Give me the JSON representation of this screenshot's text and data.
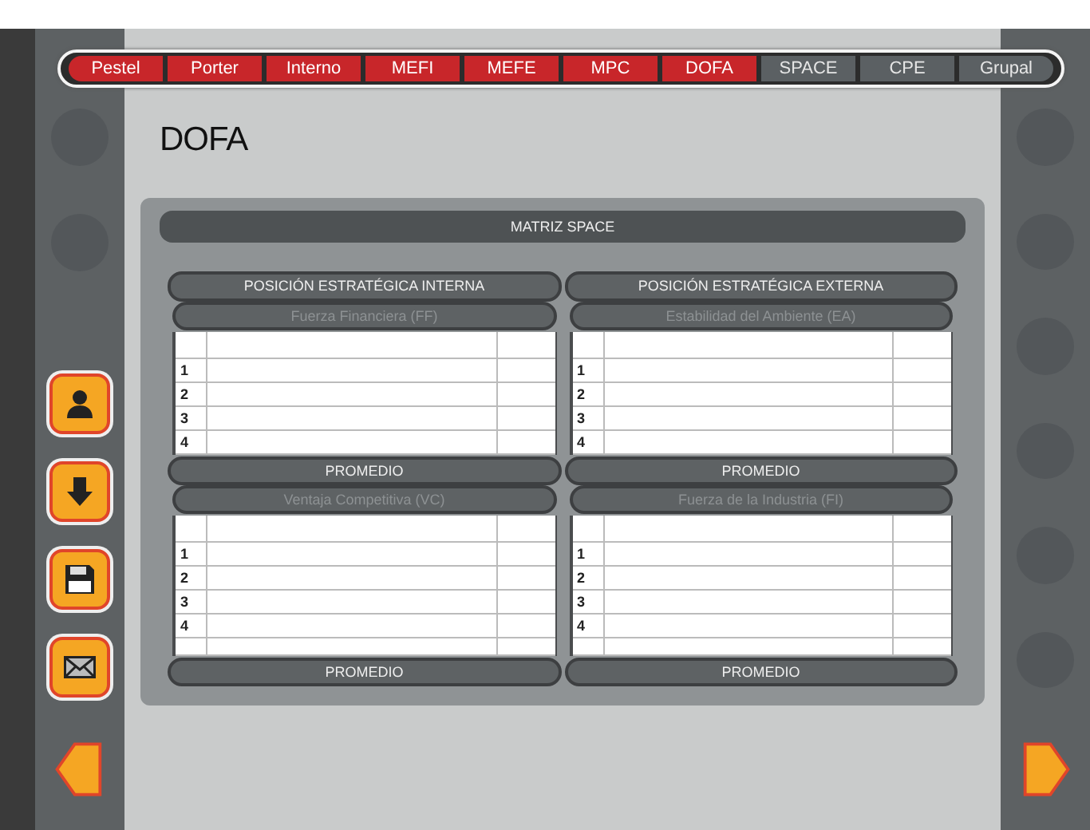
{
  "tabs": [
    {
      "label": "Pestel",
      "completed": true
    },
    {
      "label": "Porter",
      "completed": true
    },
    {
      "label": "Interno",
      "completed": true
    },
    {
      "label": "MEFI",
      "completed": true
    },
    {
      "label": "MEFE",
      "completed": true
    },
    {
      "label": "MPC",
      "completed": true
    },
    {
      "label": "DOFA",
      "completed": true
    },
    {
      "label": "SPACE",
      "completed": false
    },
    {
      "label": "CPE",
      "completed": false
    },
    {
      "label": "Grupal",
      "completed": false
    }
  ],
  "page_title": "DOFA",
  "tools": [
    {
      "kind": "user"
    },
    {
      "kind": "download"
    },
    {
      "kind": "save"
    },
    {
      "kind": "mail"
    }
  ],
  "matrix": {
    "title": "MATRIZ SPACE",
    "columns": [
      {
        "heading": "POSICIÓN ESTRATÉGICA INTERNA",
        "sections": [
          {
            "factor": "Fuerza Financiera (FF)",
            "rows": [
              "1",
              "2",
              "3",
              "4"
            ],
            "extra_row": false,
            "footer": "PROMEDIO"
          },
          {
            "factor": "Ventaja Competitiva (VC)",
            "rows": [
              "1",
              "2",
              "3",
              "4"
            ],
            "extra_row": true,
            "footer": "PROMEDIO"
          }
        ]
      },
      {
        "heading": "POSICIÓN ESTRATÉGICA EXTERNA",
        "sections": [
          {
            "factor": "Estabilidad del Ambiente (EA)",
            "rows": [
              "1",
              "2",
              "3",
              "4"
            ],
            "extra_row": false,
            "footer": "PROMEDIO"
          },
          {
            "factor": "Fuerza de la Industria (FI)",
            "rows": [
              "1",
              "2",
              "3",
              "4"
            ],
            "extra_row": true,
            "footer": "PROMEDIO"
          }
        ]
      }
    ]
  }
}
